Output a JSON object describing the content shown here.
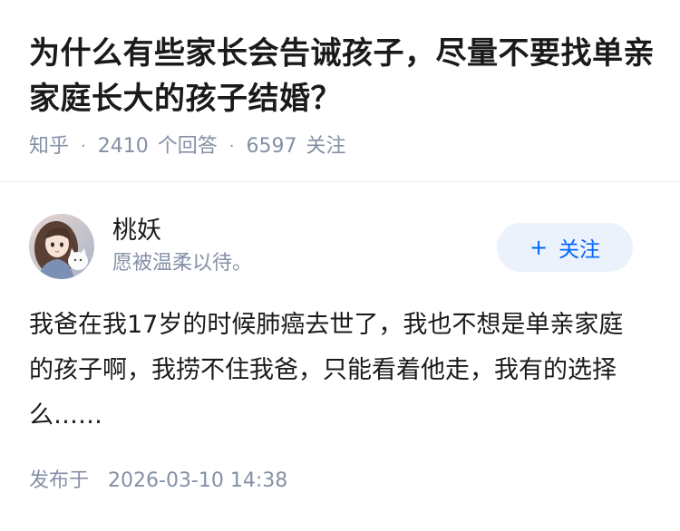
{
  "question": {
    "title": "为什么有些家长会告诫孩子，尽量不要找单亲家庭长大的孩子结婚？",
    "source": "知乎",
    "answer_count": "2410",
    "answer_label": "个回答",
    "follower_count": "6597",
    "follower_label": "关注"
  },
  "author": {
    "name": "桃妖",
    "bio": "愿被温柔以待。",
    "avatar_icon": "avatar-girl-with-cat",
    "follow_label": "关注",
    "follow_symbol": "+"
  },
  "answer": {
    "content": "我爸在我17岁的时候肺癌去世了，我也不想是单亲家庭的孩子啊，我捞不住我爸，只能看着他走，我有的选择么……"
  },
  "footer": {
    "published_label": "发布于",
    "published_time": "2026-03-10 14:38"
  },
  "colors": {
    "accent": "#0066ff",
    "follow_bg": "#ebf2fb",
    "muted_text": "#8590a6",
    "primary_text": "#1a1a1a"
  }
}
